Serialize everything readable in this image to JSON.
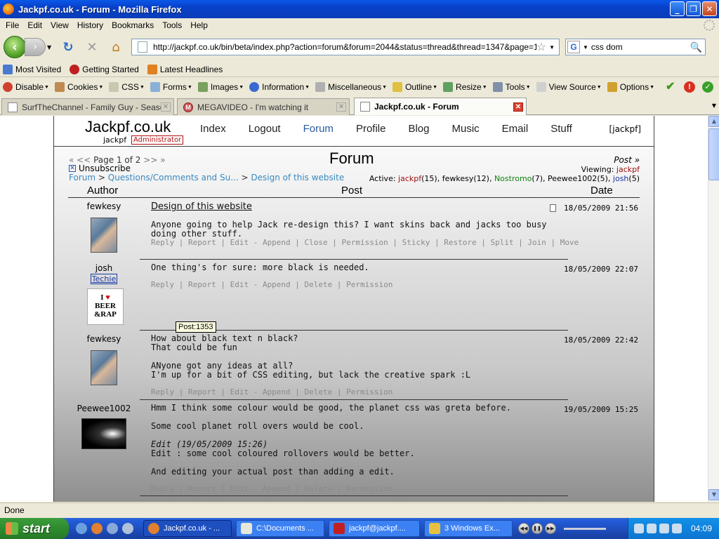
{
  "window": {
    "title": "Jackpf.co.uk - Forum - Mozilla Firefox"
  },
  "menubar": [
    "File",
    "Edit",
    "View",
    "History",
    "Bookmarks",
    "Tools",
    "Help"
  ],
  "navbar": {
    "url": "http://jackpf.co.uk/bin/beta/index.php?action=forum&forum=2044&status=thread&thread=1347&page=1",
    "search_value": "css dom"
  },
  "bookmarks": [
    {
      "label": "Most Visited",
      "icon": "blue-folder-icon"
    },
    {
      "label": "Getting Started",
      "icon": "firefox-red-icon"
    },
    {
      "label": "Latest Headlines",
      "icon": "rss-icon"
    }
  ],
  "devbar": [
    "Disable",
    "Cookies",
    "CSS",
    "Forms",
    "Images",
    "Information",
    "Miscellaneous",
    "Outline",
    "Resize",
    "Tools",
    "View Source",
    "Options"
  ],
  "tabs": [
    {
      "label": "SurfTheChannel - Family Guy - Season ..."
    },
    {
      "label": "MEGAVIDEO - I'm watching it"
    },
    {
      "label": "Jackpf.co.uk - Forum"
    }
  ],
  "site": {
    "logo": "Jackpf.co.uk",
    "user": "jackpf",
    "role": "Administrator",
    "nav": [
      "Index",
      "Logout",
      "Forum",
      "Profile",
      "Blog",
      "Music",
      "Email",
      "Stuff"
    ],
    "bracket_user": "[jackpf]"
  },
  "forum": {
    "title": "Forum",
    "pagination": "Page 1 of 2",
    "pag_prev": "« <<",
    "pag_next": ">> »",
    "unsubscribe": "Unsubscribe",
    "crumbs": {
      "c1": "Forum",
      "c2": "Questions/Comments and Su...",
      "c3": "Design of this website",
      "sep": ">"
    },
    "post_link": "Post »",
    "viewing_label": "Viewing:",
    "viewing_user": "jackpf",
    "active_label": "Active:",
    "active_users": [
      {
        "name": "jackpf",
        "count": "(15)",
        "color": "red"
      },
      {
        "name": "fewkesy",
        "count": "(12)",
        "color": "plain"
      },
      {
        "name": "Nostromo",
        "count": "(7)",
        "color": "green"
      },
      {
        "name": "Peewee1002",
        "count": "(5)",
        "color": "plain"
      },
      {
        "name": "josh",
        "count": "(5)",
        "color": "blue"
      }
    ],
    "columns": {
      "author": "Author",
      "post": "Post",
      "date": "Date"
    }
  },
  "posts": [
    {
      "author": "fewkesy",
      "subject": "Design of this website",
      "lines": [
        "Anyone going to help Jack re-design this? I want skins back and jacks too busy doing other stuff."
      ],
      "actions": "Reply | Report | Edit - Append | Close | Permission | Sticky | Restore | Split | Join | Move",
      "date": "18/05/2009 21:56"
    },
    {
      "author": "josh",
      "rank": "Techie",
      "avatar_text": {
        "line1": "I",
        "heart": "♥",
        "line2": "BEER",
        "line3": "&RAP"
      },
      "lines": [
        "One thing's for sure: more black is needed."
      ],
      "actions": "Reply | Report | Edit - Append | Delete | Permission",
      "date": "18/05/2009 22:07"
    },
    {
      "author": "fewkesy",
      "lines": [
        "How about black text n black?",
        "That could be fun",
        "",
        "ANyone got any ideas at all?",
        "I'm up for a bit of CSS editing, but lack the creative spark :L"
      ],
      "actions": "Reply | Report | Edit - Append | Delete | Permission",
      "date": "18/05/2009 22:42"
    },
    {
      "author": "Peewee1002",
      "lines": [
        "Hmm I think some colour would be good, the planet css was greta before.",
        "",
        "Some cool planet roll overs would be cool.",
        ""
      ],
      "edit_note": "Edit (19/05/2009 15:26)",
      "lines2": [
        "Edit : some cool coloured rollovers would be better.",
        "",
        "And editing your actual post than adding a edit."
      ],
      "actions": "Reply | Report | Edit - Append | Delete | Permission",
      "date": "19/05/2009 15:25"
    }
  ],
  "tooltip": "Post:1353",
  "status": "Done",
  "taskbar": {
    "start": "start",
    "tasks": [
      {
        "label": "Jackpf.co.uk - ...",
        "active": true
      },
      {
        "label": "C:\\Documents ..."
      },
      {
        "label": "jackpf@jackpf...."
      },
      {
        "label": "3 Windows Ex..."
      }
    ],
    "clock": "04:09"
  }
}
